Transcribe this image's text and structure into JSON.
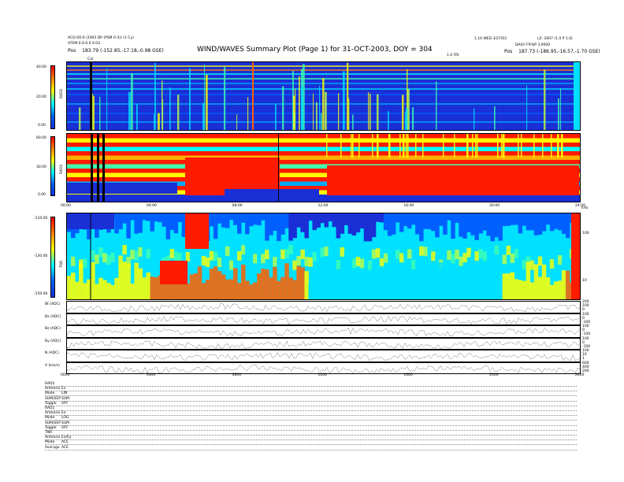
{
  "header": {
    "title": "WIND/WAVES Summary Plot (Page 1) for 31-OCT-2003, DOY = 304",
    "left_line1": "ACQ-00-0 (2003 DP (PSM 0-3)) (1 Cy)",
    "left_line2": "ATEM 0.0-0.0 0.03",
    "left_pos_label": "Pos",
    "left_pos_value": "183.79 (-152.85,-17.18,-0.98 GSE)",
    "right_line1": "DAILY FP/QP 3.0000",
    "right_pos_label": "Pos",
    "right_pos_value": "187.73 (-186.95,-16.57,-1.70 GSE)",
    "mid_right_small": "1.10 WED 3/27/03",
    "far_right_small": "LZ: 2007 (1.0 P 1.0)",
    "mid_small": "1.0 FRI"
  },
  "rad2": {
    "label": "RAD2",
    "ticks": [
      "40.00",
      "20.00",
      "0.00"
    ],
    "marker": "Cal"
  },
  "rad1": {
    "label": "RAD1",
    "ticks": [
      "60.00",
      "30.00",
      "0.00"
    ]
  },
  "time_axis_top": [
    "00:00",
    "04:00",
    "08:00",
    "12:00",
    "16:00",
    "20:00",
    "24:00"
  ],
  "tnr": {
    "label": "TNR",
    "ticks": [
      "-110.00",
      "-130.00",
      "-150.00"
    ],
    "right_ticks": [
      "100",
      "10"
    ],
    "right_tag": "kHz"
  },
  "line_panels": [
    {
      "label": "Bt (ADC)",
      "right": [
        "200",
        "100",
        "0"
      ]
    },
    {
      "label": "Bx (ADC)",
      "right": [
        "100",
        "0",
        "-100"
      ]
    },
    {
      "label": "Bz (ADC)",
      "right": [
        "100",
        "0",
        "-100"
      ]
    },
    {
      "label": "By (ADC)",
      "right": [
        "100",
        "0",
        "-100"
      ]
    },
    {
      "label": "N (ADC)",
      "right": [
        "100",
        "10",
        "1"
      ]
    },
    {
      "label": "V (km/s)",
      "right": [
        "600",
        "400",
        "200"
      ]
    }
  ],
  "time_axis_bottom": [
    "0000",
    "0400",
    "0800",
    "1200",
    "1600",
    "2000",
    "2400"
  ],
  "footer_rows": [
    {
      "k": "RAD2",
      "v": ""
    },
    {
      "k": "Antenna",
      "v": "Ex"
    },
    {
      "k": "Mode",
      "v": "LIN"
    },
    {
      "k": "SUM/SEP",
      "v": "SUM"
    },
    {
      "k": "Toggle",
      "v": "OFF"
    },
    {
      "k": "RAD1",
      "v": ""
    },
    {
      "k": "Antenna",
      "v": "Ex"
    },
    {
      "k": "Mode",
      "v": "LOG"
    },
    {
      "k": "SUM/SEP",
      "v": "SUM"
    },
    {
      "k": "Toggle",
      "v": "OFF"
    },
    {
      "k": "TNR",
      "v": ""
    },
    {
      "k": "Antenna",
      "v": "Ex/Ey"
    },
    {
      "k": "Mode",
      "v": "ACE"
    },
    {
      "k": "Average",
      "v": "ACE"
    }
  ],
  "colors": {
    "low": "#1a2fd6",
    "high": "#ff1a00",
    "line": "#000000"
  }
}
